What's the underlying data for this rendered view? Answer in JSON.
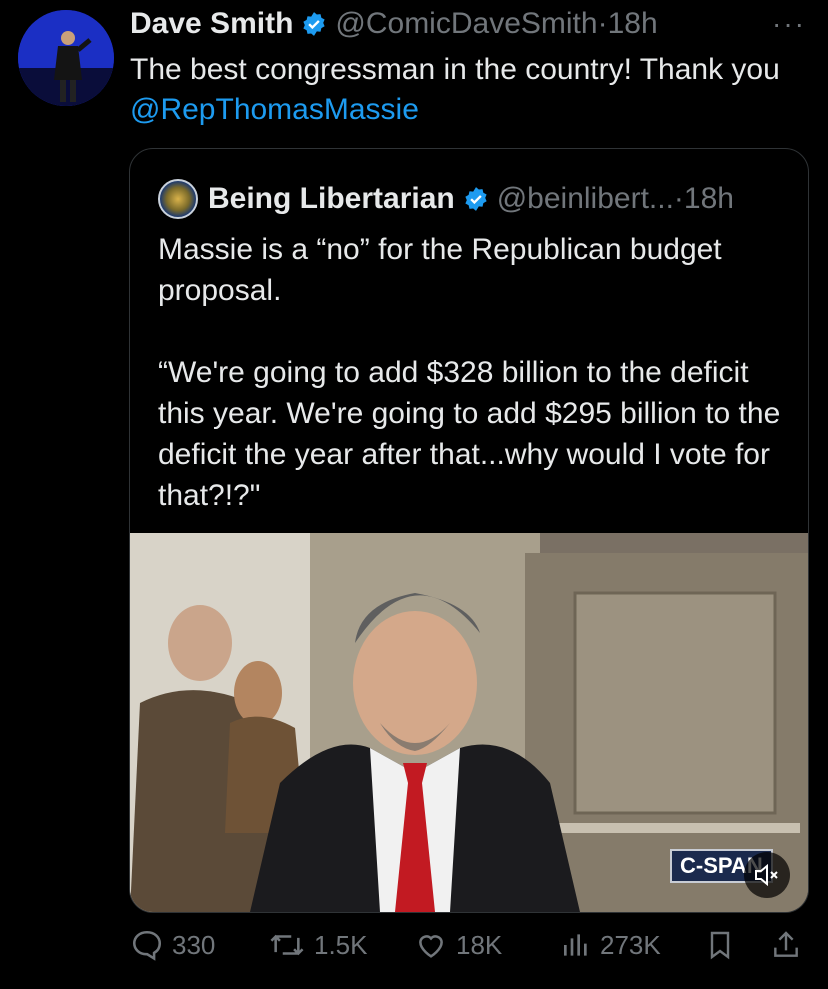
{
  "author": {
    "name": "Dave Smith",
    "handle": "@ComicDaveSmith",
    "separator": "·",
    "time": "18h",
    "more_icon": "more-icon"
  },
  "tweet": {
    "text_prefix": "The best congressman in the country! Thank you ",
    "mention": "@RepThomasMassie"
  },
  "quoted": {
    "name": "Being Libertarian",
    "handle": "@beinlibert...",
    "separator": "·",
    "time": "18h",
    "text": "Massie is a “no” for the Republican budget proposal.\n\n“We're going to add $328 billion to the deficit this year. We're going to add $295 billion to the deficit the year after that...why would I vote for that?!?\"",
    "media_badge": "C-SPAN"
  },
  "actions": {
    "replies": "330",
    "reposts": "1.5K",
    "likes": "18K",
    "views": "273K"
  },
  "colors": {
    "background": "#000000",
    "text": "#e7e9ea",
    "muted": "#71767b",
    "accent": "#1d9bf0",
    "border": "#2f3336"
  }
}
